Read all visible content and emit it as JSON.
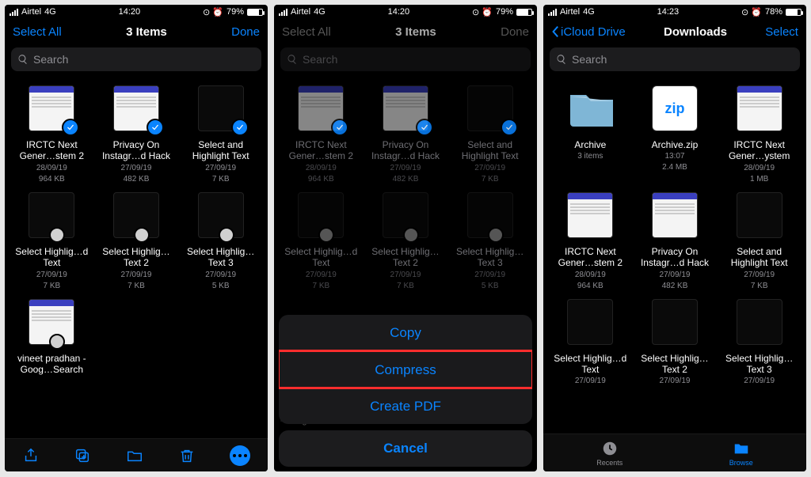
{
  "colors": {
    "accent": "#0a84ff",
    "highlight": "#ff2d2d"
  },
  "s1": {
    "status": {
      "carrier": "Airtel",
      "net": "4G",
      "time": "14:20",
      "battery": "79%"
    },
    "nav": {
      "left": "Select All",
      "title": "3 Items",
      "right": "Done"
    },
    "search": "Search",
    "files": [
      {
        "name": "IRCTC Next Gener…stem 2",
        "date": "28/09/19",
        "size": "964 KB",
        "sel": true,
        "thumb": "doc"
      },
      {
        "name": "Privacy On Instagr…d Hack",
        "date": "27/09/19",
        "size": "482 KB",
        "sel": true,
        "thumb": "doc"
      },
      {
        "name": "Select and Highlight Text",
        "date": "27/09/19",
        "size": "7 KB",
        "sel": true,
        "thumb": "dark"
      },
      {
        "name": "Select Highlig…d Text",
        "date": "27/09/19",
        "size": "7 KB",
        "sel": false,
        "thumb": "dark"
      },
      {
        "name": "Select Highlig…Text 2",
        "date": "27/09/19",
        "size": "7 KB",
        "sel": false,
        "thumb": "dark"
      },
      {
        "name": "Select Highlig…Text 3",
        "date": "27/09/19",
        "size": "5 KB",
        "sel": false,
        "thumb": "dark"
      },
      {
        "name": "vineet pradhan - Goog…Search",
        "date": "",
        "size": "",
        "sel": false,
        "thumb": "doc"
      }
    ],
    "toolbar": [
      "share-icon",
      "duplicate-icon",
      "move-icon",
      "trash-icon",
      "more-icon"
    ]
  },
  "s2": {
    "status": {
      "carrier": "Airtel",
      "net": "4G",
      "time": "14:20",
      "battery": "79%"
    },
    "nav": {
      "left": "Select All",
      "title": "3 Items",
      "right": "Done"
    },
    "search": "Search",
    "files": [
      {
        "name": "IRCTC Next Gener…stem 2",
        "date": "28/09/19",
        "size": "964 KB",
        "sel": true,
        "thumb": "doc"
      },
      {
        "name": "Privacy On Instagr…d Hack",
        "date": "27/09/19",
        "size": "482 KB",
        "sel": true,
        "thumb": "doc"
      },
      {
        "name": "Select and Highlight Text",
        "date": "27/09/19",
        "size": "7 KB",
        "sel": true,
        "thumb": "dark"
      },
      {
        "name": "Select Highlig…d Text",
        "date": "27/09/19",
        "size": "7 KB",
        "sel": false,
        "thumb": "dark"
      },
      {
        "name": "Select Highlig…Text 2",
        "date": "27/09/19",
        "size": "7 KB",
        "sel": false,
        "thumb": "dark"
      },
      {
        "name": "Select Highlig…Text 3",
        "date": "27/09/19",
        "size": "5 KB",
        "sel": false,
        "thumb": "dark"
      }
    ],
    "peek": "- Goog…Search",
    "sheet": {
      "rows": [
        "Copy",
        "Compress",
        "Create PDF"
      ],
      "highlightIndex": 1,
      "cancel": "Cancel"
    }
  },
  "s3": {
    "status": {
      "carrier": "Airtel",
      "net": "4G",
      "time": "14:23",
      "battery": "78%"
    },
    "nav": {
      "back": "iCloud Drive",
      "title": "Downloads",
      "right": "Select"
    },
    "search": "Search",
    "files": [
      {
        "name": "Archive",
        "date": "3 items",
        "size": "",
        "thumb": "folder"
      },
      {
        "name": "Archive.zip",
        "date": "13:07",
        "size": "2.4 MB",
        "thumb": "zip"
      },
      {
        "name": "IRCTC Next Gener…ystem",
        "date": "28/09/19",
        "size": "1 MB",
        "thumb": "doc"
      },
      {
        "name": "IRCTC Next Gener…stem 2",
        "date": "28/09/19",
        "size": "964 KB",
        "thumb": "doc"
      },
      {
        "name": "Privacy On Instagr…d Hack",
        "date": "27/09/19",
        "size": "482 KB",
        "thumb": "doc"
      },
      {
        "name": "Select and Highlight Text",
        "date": "27/09/19",
        "size": "7 KB",
        "thumb": "dark"
      },
      {
        "name": "Select Highlig…d Text",
        "date": "27/09/19",
        "size": "",
        "thumb": "dark"
      },
      {
        "name": "Select Highlig…Text 2",
        "date": "27/09/19",
        "size": "",
        "thumb": "dark"
      },
      {
        "name": "Select Highlig…Text 3",
        "date": "27/09/19",
        "size": "",
        "thumb": "dark"
      }
    ],
    "tabs": {
      "recents": "Recents",
      "browse": "Browse"
    }
  }
}
